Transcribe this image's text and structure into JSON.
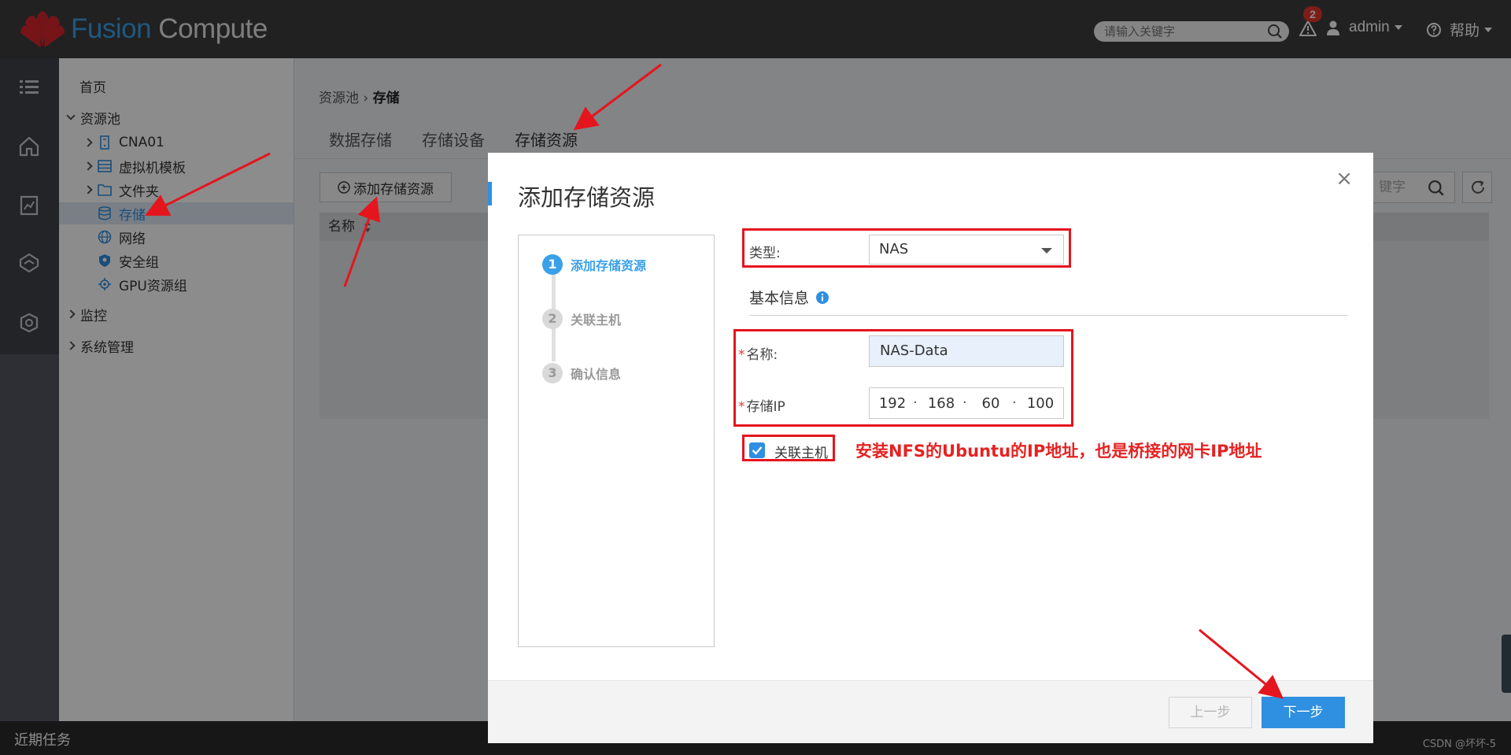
{
  "app": {
    "logo_part1": "Fusion",
    "logo_part2": "Compute"
  },
  "topbar": {
    "search_placeholder": "请输入关键字",
    "alert_count": "2",
    "user": "admin",
    "help": "帮助"
  },
  "nav": {
    "home": "首页",
    "resource_pool": "资源池",
    "items": [
      {
        "label": "CNA01",
        "icon": "host-icon"
      },
      {
        "label": "虚拟机模板",
        "icon": "template-icon"
      },
      {
        "label": "文件夹",
        "icon": "folder-icon"
      },
      {
        "label": "存储",
        "icon": "storage-icon"
      },
      {
        "label": "网络",
        "icon": "network-icon"
      },
      {
        "label": "安全组",
        "icon": "security-group-icon"
      },
      {
        "label": "GPU资源组",
        "icon": "gpu-icon"
      }
    ],
    "monitor": "监控",
    "system": "系统管理"
  },
  "main": {
    "breadcrumb_parent": "资源池",
    "breadcrumb_sep": "›",
    "breadcrumb_current": "存储",
    "tabs": [
      "数据存储",
      "存储设备",
      "存储资源"
    ],
    "add_button": "添加存储资源",
    "search_partial": "键字",
    "table_header_name": "名称"
  },
  "dialog": {
    "title": "添加存储资源",
    "close": "×",
    "steps": [
      {
        "num": "1",
        "label": "添加存储资源"
      },
      {
        "num": "2",
        "label": "关联主机"
      },
      {
        "num": "3",
        "label": "确认信息"
      }
    ],
    "type_label": "类型:",
    "type_value": "NAS",
    "section_title": "基本信息",
    "name_required": "*",
    "name_label": "名称:",
    "name_value": "NAS-Data",
    "ip_required": "*",
    "ip_label": "存储IP",
    "ip_octets": [
      "192",
      "168",
      "60",
      "100"
    ],
    "ip_dot": "·",
    "associate_host_label": "关联主机",
    "associate_host_checked": true,
    "annotation": "安装NFS的Ubuntu的IP地址，也是桥接的网卡IP地址",
    "prev_button": "上一步",
    "next_button": "下一步"
  },
  "bottombar": {
    "label": "近期任务",
    "watermark": "CSDN @坏坏-5"
  },
  "colors": {
    "accent": "#2f8fe0",
    "annotation": "#e52222",
    "topbar": "#3c3c3e"
  }
}
